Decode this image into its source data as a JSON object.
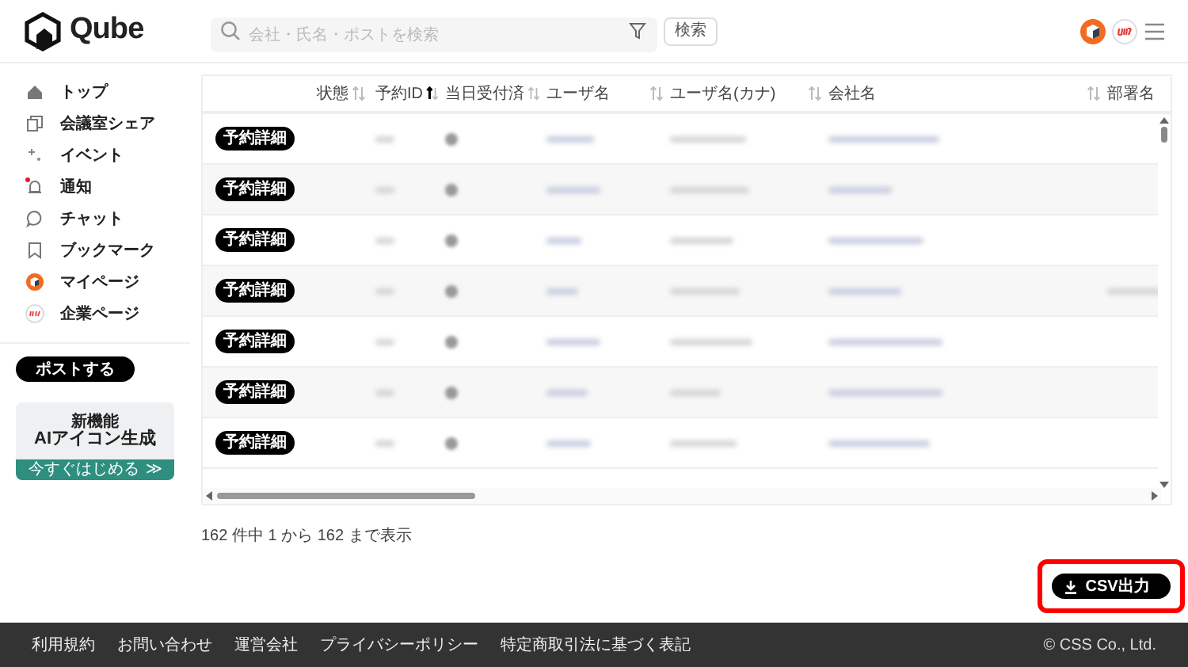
{
  "header": {
    "logo": "Qube",
    "search": {
      "placeholder": "会社・氏名・ポストを検索"
    },
    "search_button": "検索"
  },
  "sidebar": {
    "items": [
      {
        "label": "トップ",
        "kind": "home",
        "badge": false
      },
      {
        "label": "会議室シェア",
        "kind": "rooms",
        "badge": false
      },
      {
        "label": "イベント",
        "kind": "sparkle",
        "badge": false
      },
      {
        "label": "通知",
        "kind": "bell",
        "badge": true
      },
      {
        "label": "チャット",
        "kind": "chat",
        "badge": false
      },
      {
        "label": "ブックマーク",
        "kind": "bookmark",
        "badge": false
      },
      {
        "label": "マイページ",
        "kind": "avatar",
        "badge": false
      },
      {
        "label": "企業ページ",
        "kind": "company",
        "badge": false
      }
    ],
    "post_button": "ポストする",
    "banner": {
      "tag": "新機能",
      "title": "AIアイコン生成",
      "cta": "今すぐはじめる",
      "cta_arrows": "≫"
    }
  },
  "table": {
    "columns": [
      {
        "label": "状態",
        "kind": "sortable",
        "sorted": false
      },
      {
        "label": "予約ID",
        "kind": "sortable",
        "sorted": true
      },
      {
        "label": "当日受付済",
        "kind": "sortable",
        "sorted": false
      },
      {
        "label": "ユーザ名",
        "kind": "sortable",
        "sorted": false
      },
      {
        "label": "ユーザ名(カナ)",
        "kind": "sortable",
        "sorted": false
      },
      {
        "label": "会社名",
        "kind": "sortable",
        "sorted": false
      },
      {
        "label": "部署名",
        "kind": "plain"
      }
    ],
    "rows": [
      {
        "button": "予約詳細"
      },
      {
        "button": "予約詳細"
      },
      {
        "button": "予約詳細"
      },
      {
        "button": "予約詳細"
      },
      {
        "button": "予約詳細"
      },
      {
        "button": "予約詳細"
      },
      {
        "button": "予約詳細"
      }
    ],
    "summary": "162 件中 1 から 162 まで表示"
  },
  "csv_button": {
    "label": "CSV出力",
    "highlighted": true
  },
  "footer": {
    "links": [
      "利用規約",
      "お問い合わせ",
      "運営会社",
      "プライバシーポリシー",
      "特定商取引法に基づく表記"
    ],
    "copyright": "© CSS Co., Ltd."
  }
}
